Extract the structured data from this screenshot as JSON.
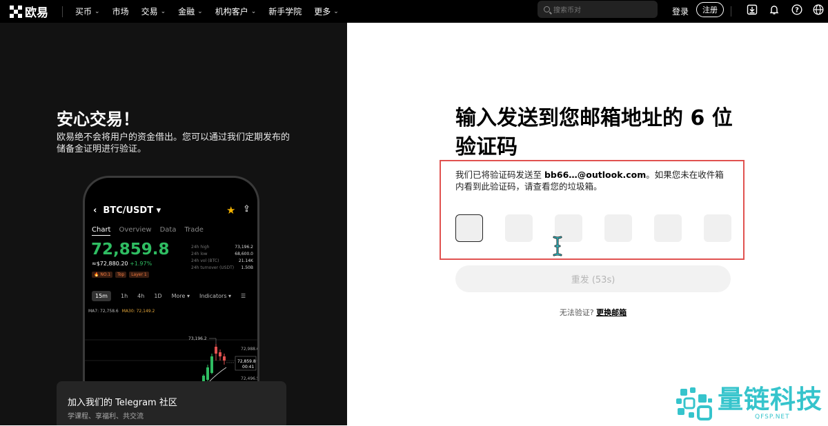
{
  "topbar": {
    "brand": "欧易",
    "nav": [
      {
        "label": "买币",
        "chevron": true
      },
      {
        "label": "市场",
        "chevron": false
      },
      {
        "label": "交易",
        "chevron": true
      },
      {
        "label": "金融",
        "chevron": true
      },
      {
        "label": "机构客户",
        "chevron": true
      },
      {
        "label": "新手学院",
        "chevron": false
      },
      {
        "label": "更多",
        "chevron": true
      }
    ],
    "search_placeholder": "搜索币对",
    "login": "登录",
    "register": "注册",
    "icons": [
      "download-icon",
      "bell-icon",
      "help-icon",
      "globe-icon"
    ]
  },
  "left": {
    "title": "安心交易！",
    "description": "欧易绝不会将用户的资金借出。您可以通过我们定期发布的储备金证明进行验证。",
    "phone": {
      "pair": "BTC/USDT",
      "tabs": [
        "Chart",
        "Overview",
        "Data",
        "Trade"
      ],
      "price": "72,859.8",
      "sub_price": "≈$72,880.20",
      "change": "+1.97%",
      "stats": [
        {
          "label": "24h high",
          "value": "73,196.2"
        },
        {
          "label": "24h low",
          "value": "68,600.0"
        },
        {
          "label": "24h vol (BTC)",
          "value": "21.14K"
        },
        {
          "label": "24h turnover (USDT)",
          "value": "1.50B"
        }
      ],
      "tags": [
        "🔥 NO.1",
        "Top",
        "Layer 1"
      ],
      "timeframes": [
        "15m",
        "1h",
        "4h",
        "1D",
        "More ▾",
        "Indicators ▾"
      ],
      "ma7": "MA7: 72,758.6",
      "ma30": "MA30: 72,149.2",
      "chart_labels": {
        "high": "73,196.2",
        "level1": "72,988.6",
        "last": "72,859.8",
        "countdown": "00:41",
        "level2": "72,496.5"
      }
    },
    "telegram": {
      "title": "加入我们的 Telegram 社区",
      "subtitle": "学课程、享福利、共交流"
    }
  },
  "right": {
    "heading": "输入发送到您邮箱地址的 6 位验证码",
    "info_prefix": "我们已将验证码发送至 ",
    "email": "bb66…@outlook.com",
    "info_suffix": "。如果您未在收件箱内看到此验证码，请查看您的垃圾箱。",
    "code_length": 6,
    "resend_label": "重发 (53s)",
    "cant_verify": "无法验证?",
    "change_email": "更换邮箱"
  },
  "watermark": {
    "text": "量链科技",
    "url": "QFSP.NET",
    "color": "#36c4cc"
  },
  "colors": {
    "accent_green": "#2fbd62",
    "highlight_red": "#e0514f",
    "dark_bg": "#121212"
  }
}
